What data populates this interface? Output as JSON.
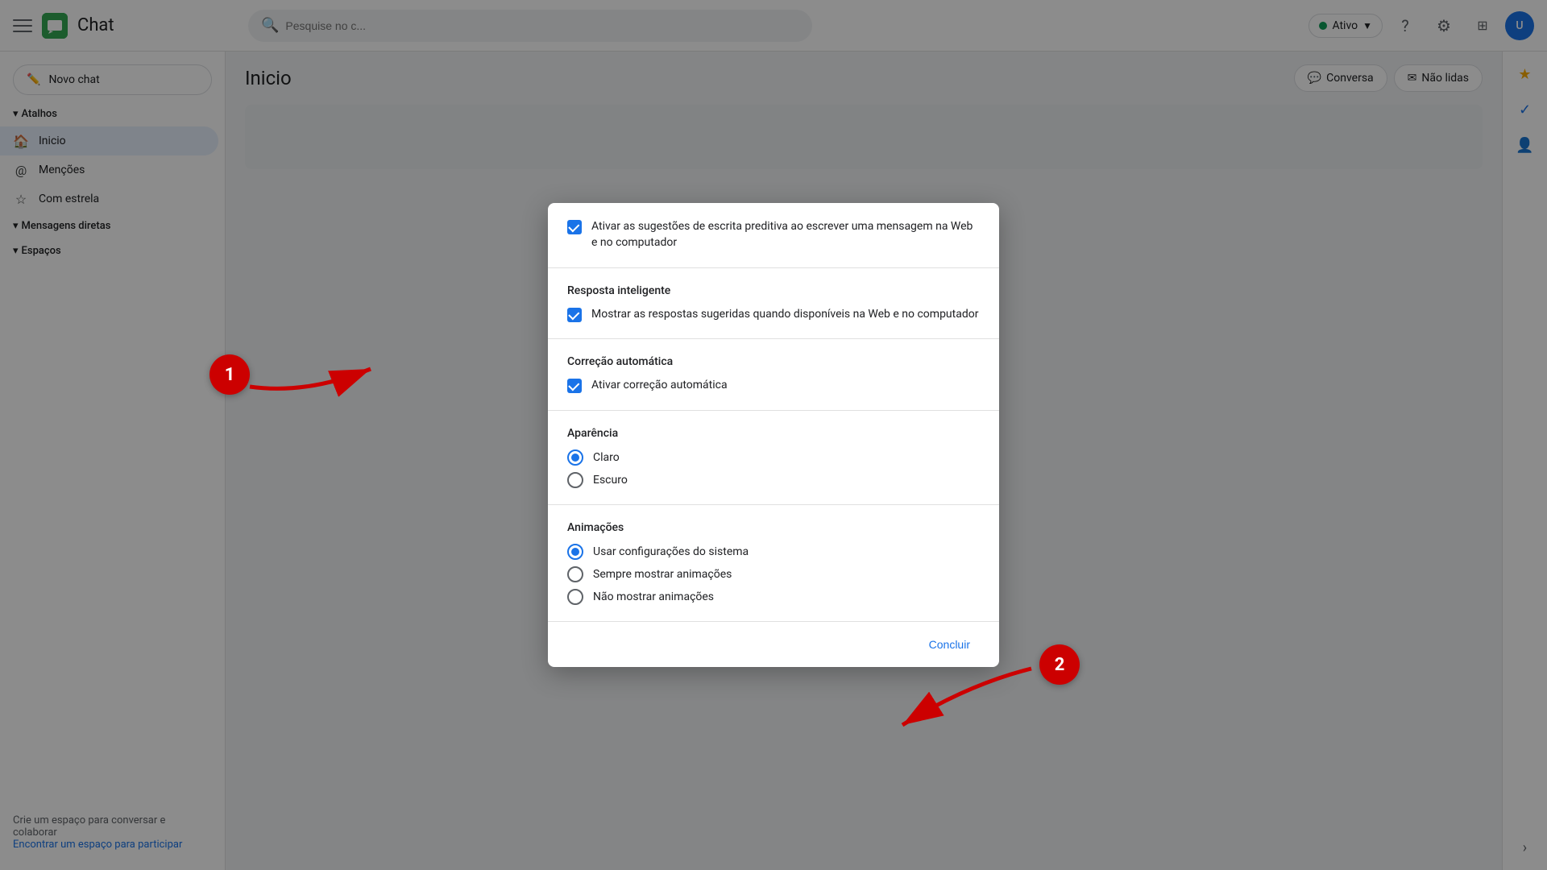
{
  "app": {
    "title": "Chat",
    "logo_alt": "Google Chat logo"
  },
  "topbar": {
    "search_placeholder": "Pesquise no c...",
    "status_label": "Ativo",
    "help_icon": "?",
    "settings_icon": "⚙",
    "grid_icon": "⊞",
    "avatar_initials": "U"
  },
  "sidebar": {
    "new_chat_label": "Novo chat",
    "shortcuts_section": "Atalhos",
    "inicio_label": "Inicio",
    "mencoes_label": "Menções",
    "com_estrela_label": "Com estrela",
    "direct_messages_section": "Mensagens diretas",
    "spaces_section": "Espaços",
    "bottom_text": "Crie um espaço para conversar e colaborar",
    "bottom_link": "Encontrar um espaço para participar"
  },
  "content": {
    "title": "Inicio",
    "conversa_btn": "Conversa",
    "nao_lidas_btn": "Não lidas"
  },
  "modal": {
    "sections": [
      {
        "id": "predictive_writing",
        "checkbox_checked": true,
        "checkbox_label": "Ativar as sugestões de escrita preditiva ao escrever uma mensagem na Web e no computador"
      },
      {
        "id": "smart_reply",
        "title": "Resposta inteligente",
        "checkbox_checked": true,
        "checkbox_label": "Mostrar as respostas sugeridas quando disponíveis na Web e no computador"
      },
      {
        "id": "autocorrect",
        "title": "Correção automática",
        "checkbox_checked": true,
        "checkbox_label": "Ativar correção automática"
      },
      {
        "id": "appearance",
        "title": "Aparência",
        "options": [
          {
            "id": "claro",
            "label": "Claro",
            "selected": true
          },
          {
            "id": "escuro",
            "label": "Escuro",
            "selected": false
          }
        ]
      },
      {
        "id": "animations",
        "title": "Animações",
        "options": [
          {
            "id": "system",
            "label": "Usar configurações do sistema",
            "selected": true
          },
          {
            "id": "always",
            "label": "Sempre mostrar animações",
            "selected": false
          },
          {
            "id": "never",
            "label": "Não mostrar animações",
            "selected": false
          }
        ]
      }
    ],
    "footer_btn": "Concluir"
  },
  "annotations": [
    {
      "number": "1"
    },
    {
      "number": "2"
    }
  ]
}
